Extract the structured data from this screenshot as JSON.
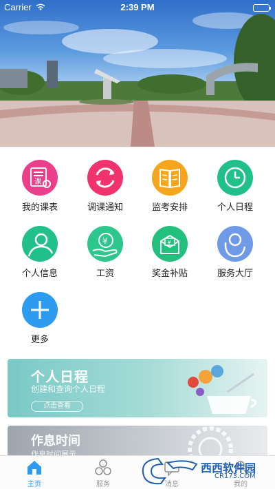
{
  "status_bar": {
    "carrier": "Carrier",
    "time": "2:39 PM"
  },
  "menu": [
    {
      "label": "我的课表",
      "icon": "timetable-icon",
      "color": "#ea3f8a"
    },
    {
      "label": "调课通知",
      "icon": "refresh-icon",
      "color": "#f0336e"
    },
    {
      "label": "监考安排",
      "icon": "book-icon",
      "color": "#f6a51e"
    },
    {
      "label": "个人日程",
      "icon": "clock-icon",
      "color": "#21c08b"
    },
    {
      "label": "个人信息",
      "icon": "person-icon",
      "color": "#21c08b"
    },
    {
      "label": "工资",
      "icon": "salary-icon",
      "color": "#2dc78d"
    },
    {
      "label": "奖金补贴",
      "icon": "bonus-envelope-icon",
      "color": "#23bf7c"
    },
    {
      "label": "服务大厅",
      "icon": "service-hall-icon",
      "color": "#6e9ae8"
    },
    {
      "label": "更多",
      "icon": "plus-icon",
      "color": "#2d9cf0"
    }
  ],
  "banners": [
    {
      "title": "个人日程",
      "subtitle": "创建和查询个人日程",
      "button": "点击查看"
    },
    {
      "title": "作息时间",
      "subtitle": "作息时间展示"
    }
  ],
  "tabbar": [
    {
      "label": "主页",
      "icon": "home-icon",
      "active": true
    },
    {
      "label": "服务",
      "icon": "service-icon",
      "active": false
    },
    {
      "label": "消息",
      "icon": "message-icon",
      "active": false
    },
    {
      "label": "我的",
      "icon": "profile-icon",
      "active": false
    }
  ],
  "watermark": {
    "text": "西西软件园",
    "sub": "CR173.COM"
  }
}
